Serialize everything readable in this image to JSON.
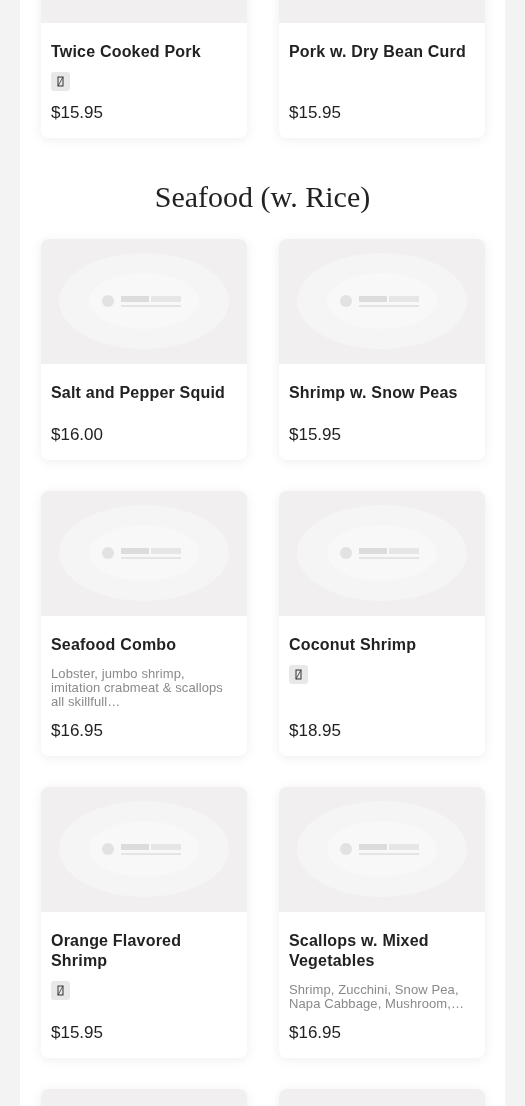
{
  "sections": [
    {
      "items": [
        {
          "kind": "dish",
          "name": "Twice Cooked Pork",
          "badge": true,
          "price": "$15.95"
        },
        {
          "kind": "dish",
          "name": "Pork w. Dry Bean Curd",
          "badge": false,
          "price": "$15.95"
        }
      ]
    },
    {
      "title": "Seafood (w. Rice)",
      "items": [
        {
          "kind": "dish",
          "name": "Salt and Pepper Squid",
          "badge": false,
          "price": "$16.00"
        },
        {
          "kind": "dish",
          "name": "Shrimp w. Snow Peas",
          "badge": false,
          "price": "$15.95"
        },
        {
          "kind": "dish",
          "name": "Seafood Combo",
          "badge": false,
          "description": "Lobster, jumbo shrimp, imitation crabmeat & scallops all skillfull…",
          "price": "$16.95"
        },
        {
          "kind": "dish",
          "name": "Coconut Shrimp",
          "badge": true,
          "price": "$18.95"
        },
        {
          "kind": "dish",
          "name": "Orange Flavored Shrimp",
          "badge": true,
          "price": "$15.95"
        },
        {
          "kind": "dish",
          "name": "Scallops w. Mixed Vegetables",
          "badge": false,
          "description": "Shrimp, Zucchini, Snow Pea, Napa Cabbage, Mushroom,…",
          "price": "$16.95"
        },
        {
          "kind": "cut"
        },
        {
          "kind": "cut"
        }
      ]
    }
  ]
}
